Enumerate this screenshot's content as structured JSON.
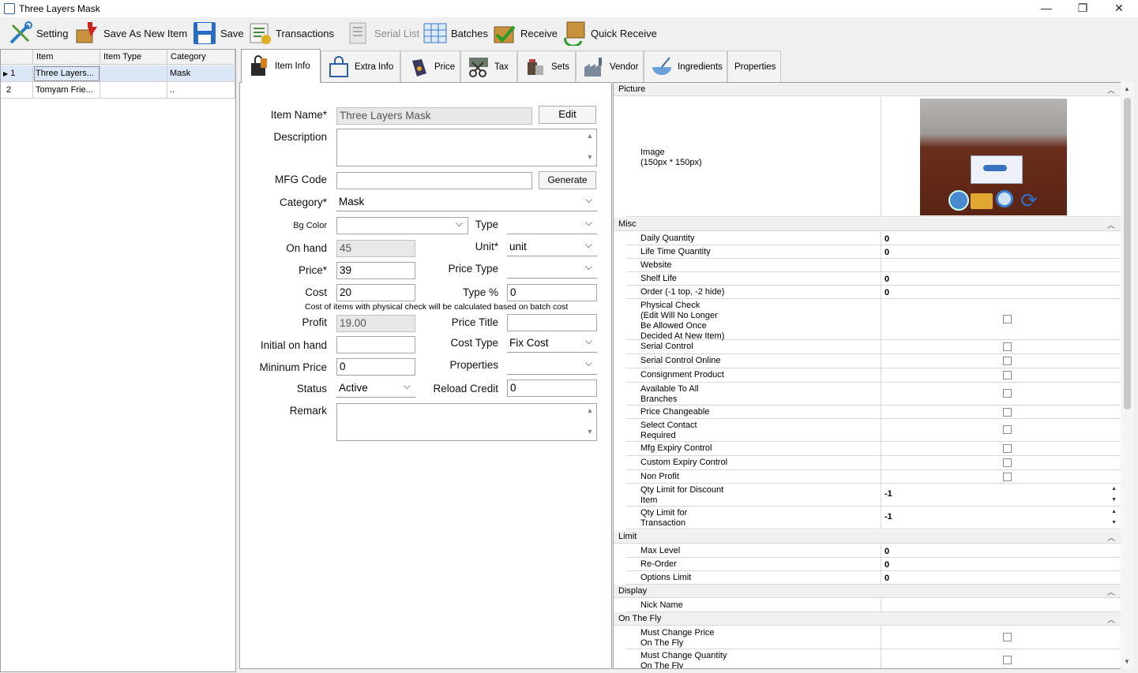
{
  "window": {
    "title": "Three Layers Mask"
  },
  "toolbar": {
    "setting": "Setting",
    "save_as_new": "Save As New Item",
    "save": "Save",
    "transactions": "Transactions",
    "serial_list": "Serial List",
    "batches": "Batches",
    "receive": "Receive",
    "quick_receive": "Quick Receive"
  },
  "grid": {
    "headers": [
      "Item",
      "Item Type",
      "Category"
    ],
    "rows": [
      {
        "num": "1",
        "item": "Three Layers...",
        "type": "",
        "category": "Mask"
      },
      {
        "num": "2",
        "item": "Tomyam Frie...",
        "type": "",
        "category": ".."
      }
    ]
  },
  "tabs": [
    "Item Info",
    "Extra Info",
    "Price",
    "Tax",
    "Sets",
    "Vendor",
    "Ingredients",
    "Properties"
  ],
  "form": {
    "item_name_label": "Item Name*",
    "item_name": "Three Layers Mask",
    "edit": "Edit",
    "description_label": "Description",
    "mfg_code_label": "MFG Code",
    "generate": "Generate",
    "category_label": "Category*",
    "category": "Mask",
    "bg_color_label": "Bg Color",
    "type_label": "Type",
    "on_hand_label": "On hand",
    "on_hand": "45",
    "unit_label": "Unit*",
    "unit": "unit",
    "price_label": "Price*",
    "price": "39",
    "price_type_label": "Price Type",
    "cost_label": "Cost",
    "cost": "20",
    "type_pct_label": "Type %",
    "type_pct": "0",
    "cost_note": "Cost of items with physical check will be calculated based on batch cost",
    "profit_label": "Profit",
    "profit": "19.00",
    "price_title_label": "Price Title",
    "initial_on_hand_label": "Initial on hand",
    "cost_type_label": "Cost Type",
    "cost_type": "Fix Cost",
    "min_price_label": "Mininum Price",
    "min_price": "0",
    "properties_label": "Properties",
    "status_label": "Status",
    "status": "Active",
    "reload_credit_label": "Reload Credit",
    "reload_credit": "0",
    "remark_label": "Remark"
  },
  "props": {
    "picture_cat": "Picture",
    "image_label": "Image",
    "image_size": "(150px * 150px)",
    "misc_cat": "Misc",
    "daily_qty": "Daily Quantity",
    "daily_qty_v": "0",
    "lifetime_qty": "Life Time Quantity",
    "lifetime_qty_v": "0",
    "website": "Website",
    "shelf_life": "Shelf Life",
    "shelf_life_v": "0",
    "order": "Order (-1 top, -2 hide)",
    "order_v": "0",
    "physical_check_1": "Physical Check",
    "physical_check_2": "(Edit Will No Longer",
    "physical_check_3": "Be Allowed Once",
    "physical_check_4": "Decided At New Item)",
    "serial_control": "Serial Control",
    "serial_online": "Serial Control Online",
    "consignment": "Consignment Product",
    "avail_all_1": "Available To All",
    "avail_all_2": "Branches",
    "price_changeable": "Price Changeable",
    "select_contact_1": "Select Contact",
    "select_contact_2": "Required",
    "mfg_expiry": "Mfg Expiry Control",
    "custom_expiry": "Custom Expiry Control",
    "non_profit": "Non Profit",
    "qty_disc_1": "Qty Limit for Discount",
    "qty_disc_2": "Item",
    "qty_disc_v": "-1",
    "qty_trans_1": "Qty Limit for",
    "qty_trans_2": "Transaction",
    "qty_trans_v": "-1",
    "limit_cat": "Limit",
    "max_level": "Max Level",
    "max_level_v": "0",
    "reorder": "Re-Order",
    "reorder_v": "0",
    "options_limit": "Options Limit",
    "options_limit_v": "0",
    "display_cat": "Display",
    "nick_name": "Nick Name",
    "onthefly_cat": "On The Fly",
    "must_price_1": "Must Change Price",
    "must_price_2": "On The Fly",
    "must_qty_1": "Must Change Quantity",
    "must_qty_2": "On The Fly"
  }
}
